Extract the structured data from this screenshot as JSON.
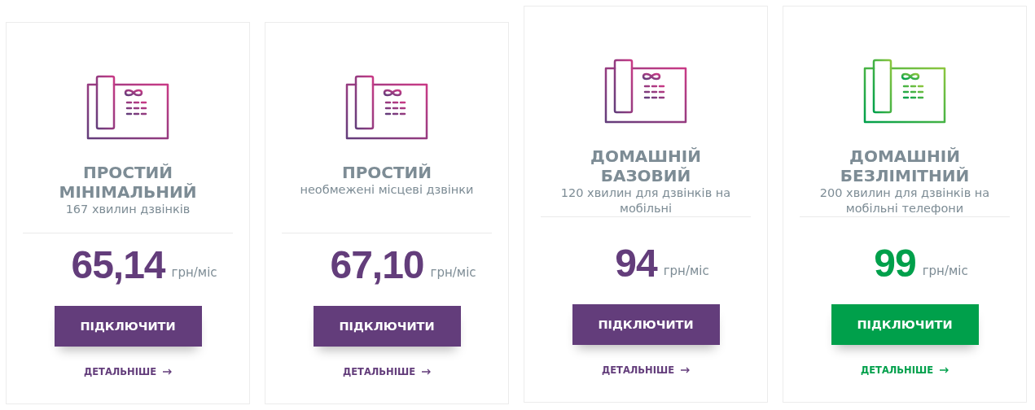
{
  "plans": [
    {
      "title": "ПРОСТИЙ МІНІМАЛЬНИЙ",
      "subtitle": "167 хвилин дзвінків",
      "price": "65,14",
      "unit": "грн/міс",
      "button": "ПІДКЛЮЧИТИ",
      "link": "ДЕТАЛЬНІШЕ",
      "color": "#633d7b",
      "raised": false
    },
    {
      "title": "ПРОСТИЙ",
      "subtitle": "необмежені місцеві дзвінки",
      "price": "67,10",
      "unit": "грн/міс",
      "button": "ПІДКЛЮЧИТИ",
      "link": "ДЕТАЛЬНІШЕ",
      "color": "#633d7b",
      "raised": false
    },
    {
      "title": "ДОМАШНІЙ БАЗОВИЙ",
      "subtitle": "120 хвилин для дзвінків на мобільні",
      "price": "94",
      "unit": "грн/міс",
      "button": "ПІДКЛЮЧИТИ",
      "link": "ДЕТАЛЬНІШЕ",
      "color": "#633d7b",
      "raised": true
    },
    {
      "title": "ДОМАШНІЙ БЕЗЛІМІТНИЙ",
      "subtitle": "200 хвилин для дзвінків на мобільні телефони",
      "price": "99",
      "unit": "грн/міс",
      "button": "ПІДКЛЮЧИТИ",
      "link": "ДЕТАЛЬНІШЕ",
      "color": "#00a04b",
      "raised": true
    }
  ]
}
